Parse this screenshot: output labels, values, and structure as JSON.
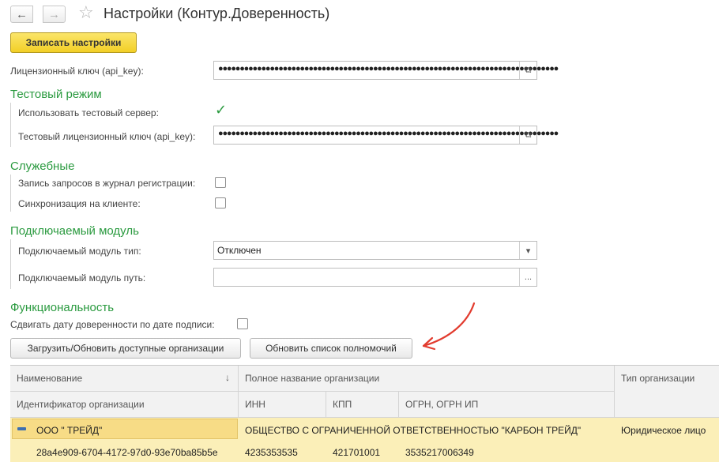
{
  "header": {
    "title": "Настройки (Контур.Доверенность)",
    "back_icon": "←",
    "forward_icon": "→",
    "favorite_icon": "☆"
  },
  "toolbar": {
    "save_label": "Записать настройки"
  },
  "main": {
    "api_key_label": "Лицензионный ключ (api_key):",
    "api_key_value": "●●●●●●●●●●●●●●●●●●●●●●●●●●●●●●●●●●●●●●●●●●●●●●●●●●●●●●●●●●●●●●●●●●●●●●●●●●●●●●●",
    "open_icon": "⧉"
  },
  "test_mode": {
    "title": "Тестовый режим",
    "use_test_server_label": "Использовать тестовый сервер:",
    "use_test_server_checked": true,
    "checkmark": "✓",
    "test_key_label": "Тестовый лицензионный ключ (api_key):",
    "test_key_value": "●●●●●●●●●●●●●●●●●●●●●●●●●●●●●●●●●●●●●●●●●●●●●●●●●●●●●●●●●●●●●●●●●●●●●●●●●●●●●●●"
  },
  "service": {
    "title": "Служебные",
    "log_requests_label": "Запись запросов в журнал регистрации:",
    "log_requests_checked": false,
    "client_sync_label": "Синхронизация на клиенте:",
    "client_sync_checked": false
  },
  "plugin": {
    "title": "Подключаемый модуль",
    "type_label": "Подключаемый модуль тип:",
    "type_value": "Отключен",
    "dropdown_icon": "▾",
    "path_label": "Подключаемый модуль путь:",
    "path_value": "",
    "browse_label": "..."
  },
  "functionality": {
    "title": "Функциональность",
    "shift_date_label": "Сдвигать дату доверенности по дате подписи:",
    "shift_date_checked": false,
    "load_orgs_label": "Загрузить/Обновить доступные организации",
    "refresh_powers_label": "Обновить список полномочий"
  },
  "table": {
    "headers": {
      "name": "Наименование",
      "sort_icon": "↓",
      "full_name": "Полное название организации",
      "org_type": "Тип организации",
      "org_id": "Идентификатор организации",
      "inn": "ИНН",
      "kpp": "КПП",
      "ogrn": "ОГРН, ОГРН ИП"
    },
    "rows": [
      {
        "name": "ООО \" ТРЕЙД\"",
        "full_name": "ОБЩЕСТВО С ОГРАНИЧЕННОЙ ОТВЕТСТВЕННОСТЬЮ \"КАРБОН ТРЕЙД\"",
        "org_type": "Юридическое лицо",
        "org_id": "28a4e909-6704-4172-97d0-93e70ba85b5e",
        "inn": "4235353535",
        "kpp": "421701001",
        "ogrn": "3535217006349"
      }
    ]
  },
  "colors": {
    "accent_green": "#2a9a3f",
    "save_yellow": "#f2cf26",
    "selection": "#fbefb8",
    "arrow_red": "#e23b2e"
  }
}
